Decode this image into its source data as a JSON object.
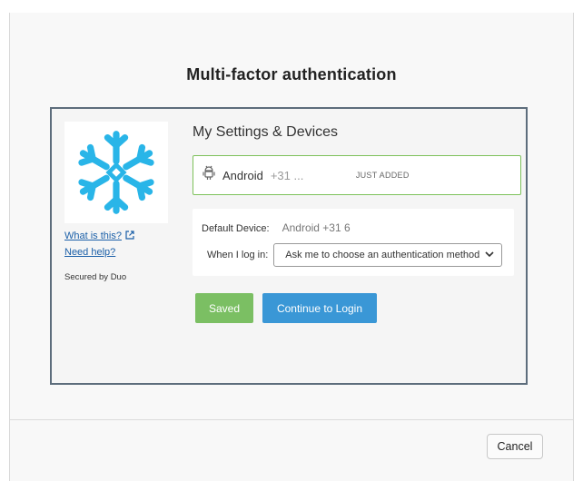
{
  "dialog": {
    "title": "Multi-factor authentication",
    "cancel_label": "Cancel"
  },
  "duo": {
    "logo_icon": "snowflake-logo-icon",
    "brand_color": "#29b5e8",
    "links": {
      "what_is_this": "What is this?",
      "need_help": "Need help?"
    },
    "secured_by": "Secured by Duo",
    "heading": "My Settings & Devices",
    "device": {
      "icon": "android-icon",
      "name": "Android",
      "number": "+31 ...",
      "badge": "JUST ADDED"
    },
    "settings": {
      "default_device_label": "Default Device:",
      "default_device_value": "Android +31 6",
      "when_login_label": "When I log in:",
      "when_login_selected": "Ask me to choose an authentication method"
    },
    "buttons": {
      "saved": "Saved",
      "continue": "Continue to Login"
    }
  }
}
